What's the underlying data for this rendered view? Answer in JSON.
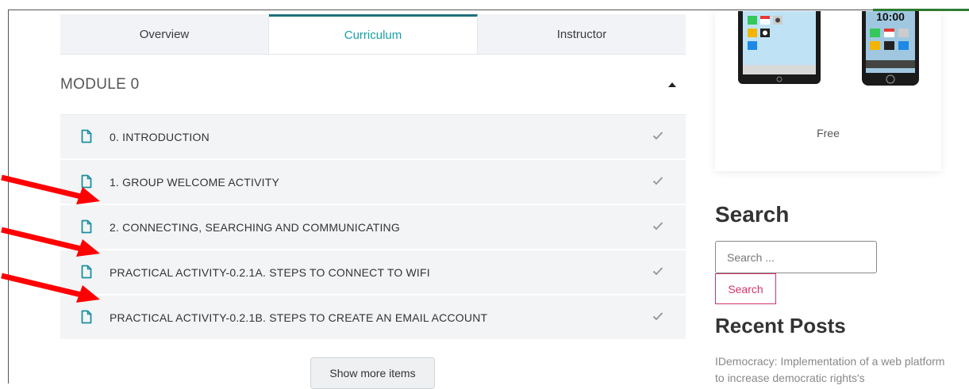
{
  "tabs": [
    {
      "label": "Overview",
      "active": false
    },
    {
      "label": "Curriculum",
      "active": true
    },
    {
      "label": "Instructor",
      "active": false
    }
  ],
  "module": {
    "title": "MODULE 0",
    "lessons": [
      {
        "label": "0. INTRODUCTION",
        "completed": true
      },
      {
        "label": "1. GROUP WELCOME ACTIVITY",
        "completed": true
      },
      {
        "label": "2. CONNECTING, SEARCHING AND COMMUNICATING",
        "completed": true
      },
      {
        "label": "PRACTICAL ACTIVITY-0.2.1A. STEPS TO CONNECT TO WIFI",
        "completed": true
      },
      {
        "label": "PRACTICAL ACTIVITY-0.2.1B. STEPS TO CREATE AN EMAIL ACCOUNT",
        "completed": true
      }
    ]
  },
  "show_more_label": "Show more items",
  "sidebar": {
    "course_price": "Free",
    "phone_clock": "10:00",
    "search": {
      "title": "Search",
      "placeholder": "Search ...",
      "button_label": "Search"
    },
    "recent_posts": {
      "title": "Recent Posts",
      "first_post": "IDemocracy: Implementation of a web platform to increase democratic rights's"
    }
  },
  "colors": {
    "accent_teal": "#17a0a7",
    "search_button": "#d6336c",
    "annotation_arrow": "#ff0000"
  }
}
